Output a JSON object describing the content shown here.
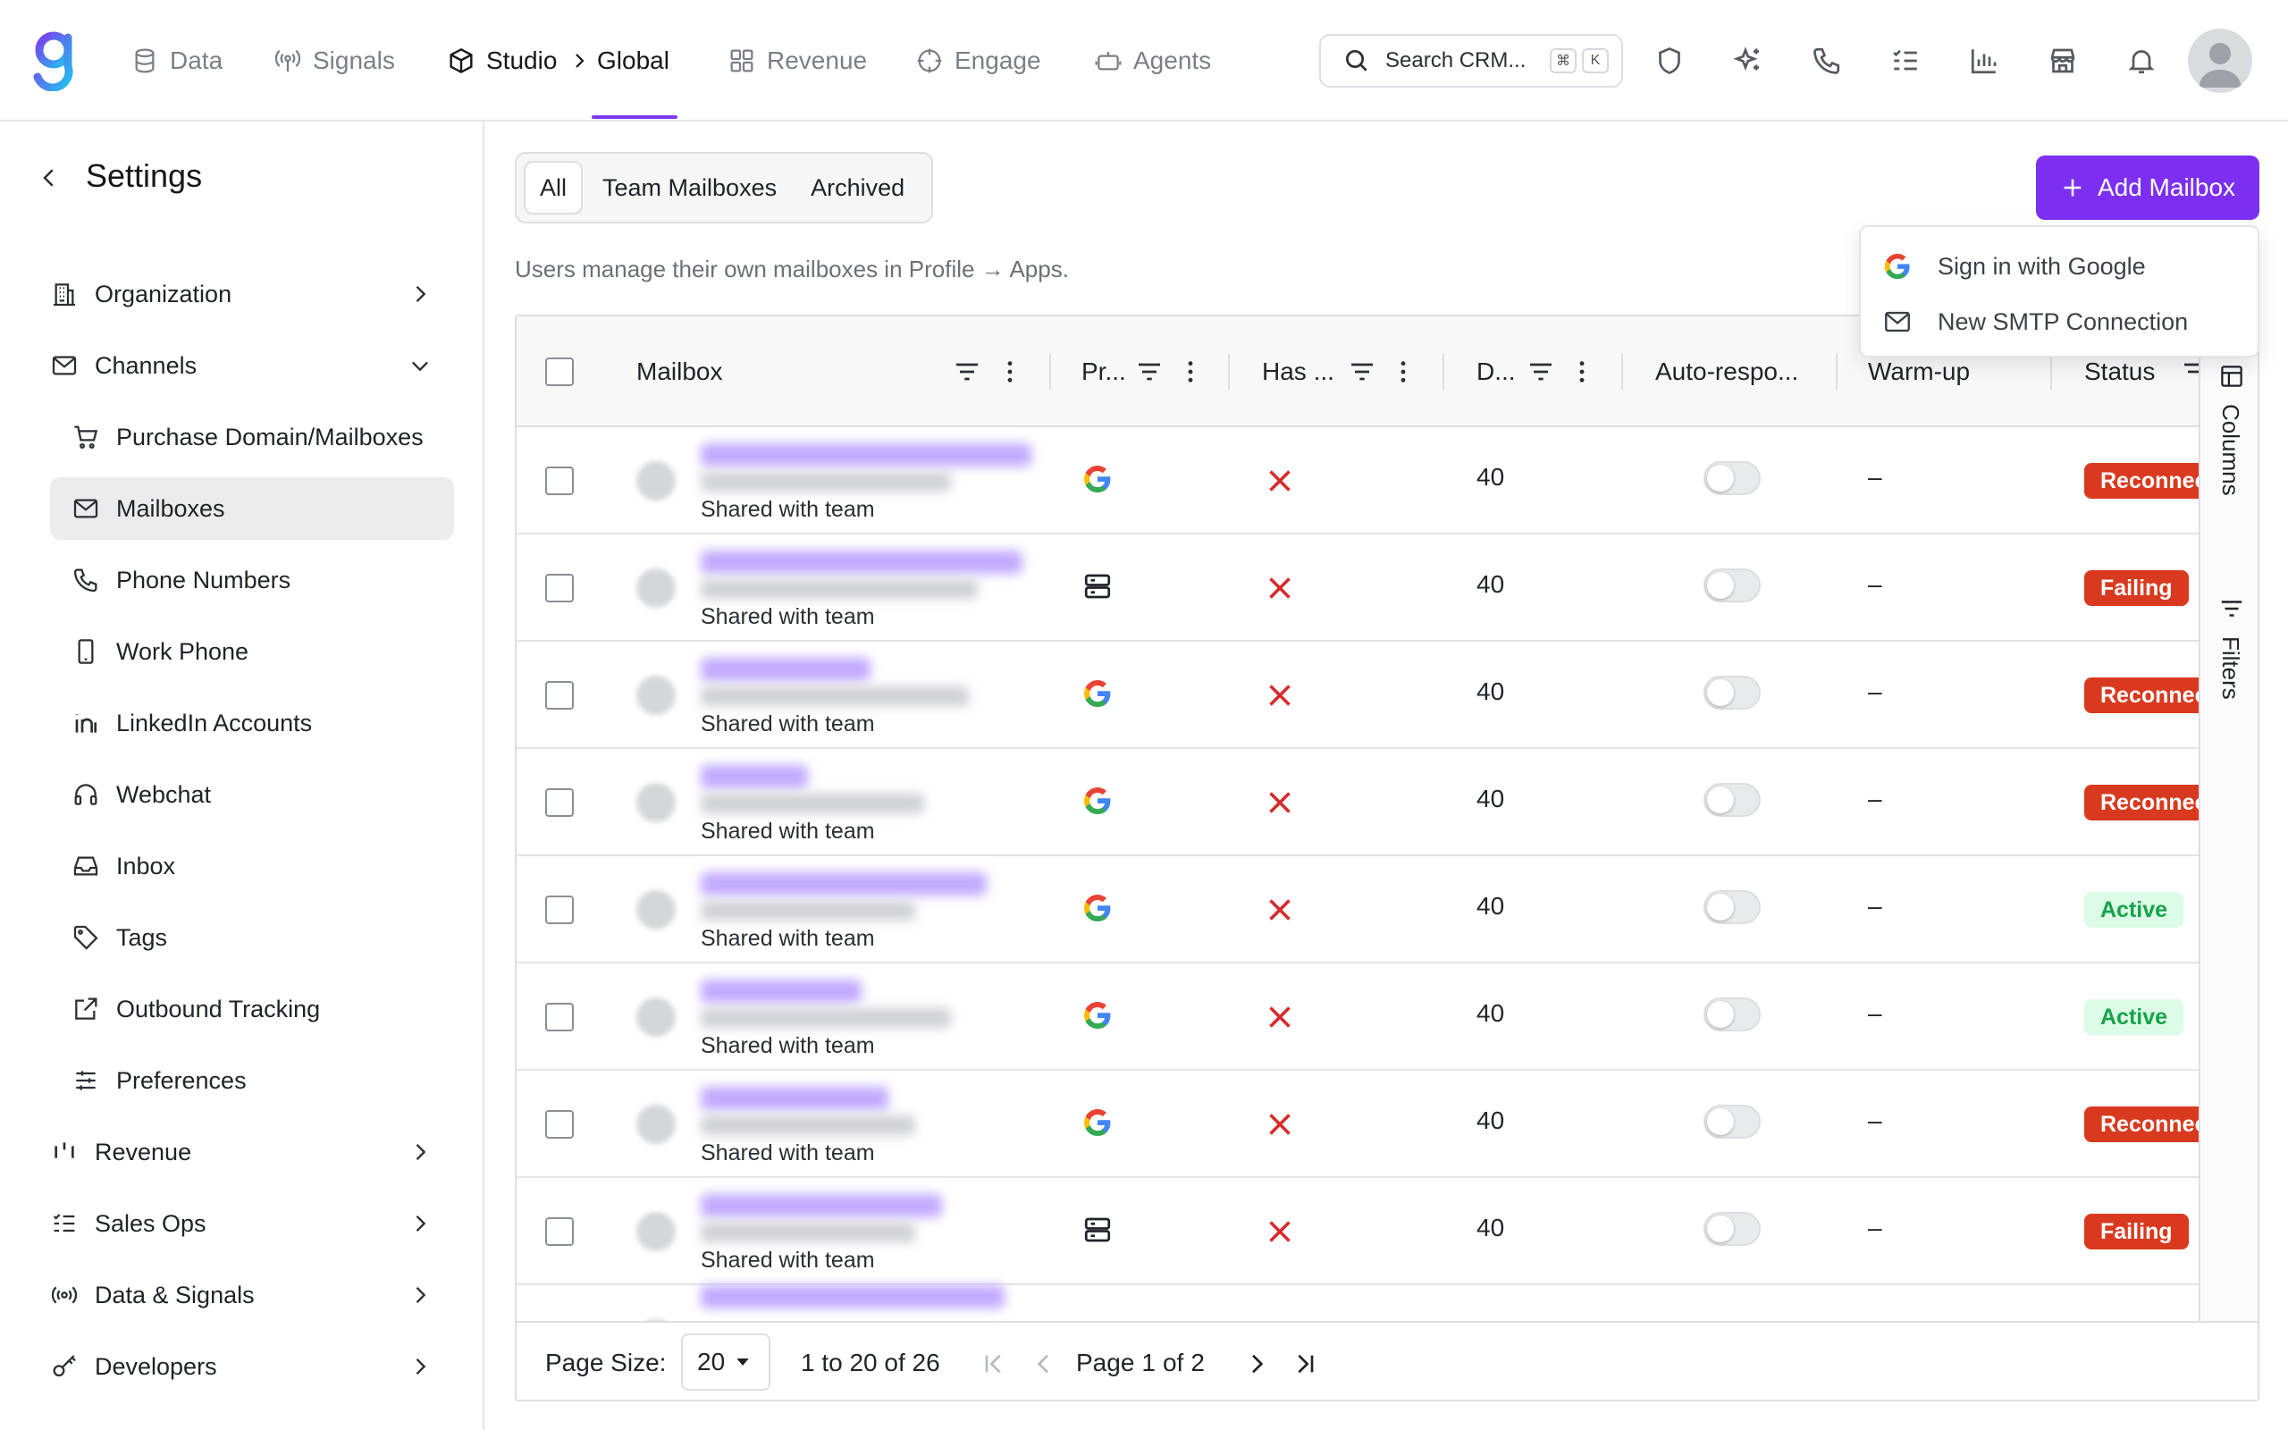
{
  "topnav": {
    "items": [
      {
        "label": "Data",
        "icon": "database-icon"
      },
      {
        "label": "Signals",
        "icon": "signal-icon"
      },
      {
        "label": "Studio",
        "icon": "cube-icon"
      },
      {
        "label": "Global"
      },
      {
        "label": "Revenue",
        "icon": "grid-icon"
      },
      {
        "label": "Engage",
        "icon": "target-icon"
      },
      {
        "label": "Agents",
        "icon": "bot-icon"
      }
    ],
    "search": {
      "placeholder": "Search CRM...",
      "key1": "⌘",
      "key2": "K"
    },
    "accent": "#7c3aed"
  },
  "sidebar": {
    "title": "Settings",
    "items": [
      {
        "label": "Organization"
      },
      {
        "label": "Channels"
      },
      {
        "label": "Purchase Domain/Mailboxes"
      },
      {
        "label": "Mailboxes"
      },
      {
        "label": "Phone Numbers"
      },
      {
        "label": "Work Phone"
      },
      {
        "label": "LinkedIn Accounts"
      },
      {
        "label": "Webchat"
      },
      {
        "label": "Inbox"
      },
      {
        "label": "Tags"
      },
      {
        "label": "Outbound Tracking"
      },
      {
        "label": "Preferences"
      },
      {
        "label": "Revenue"
      },
      {
        "label": "Sales Ops"
      },
      {
        "label": "Data & Signals"
      },
      {
        "label": "Developers"
      }
    ]
  },
  "tabs": {
    "all": "All",
    "team": "Team Mailboxes",
    "archived": "Archived"
  },
  "helper_text": "Users manage their own mailboxes in Profile → Apps.",
  "add_button": {
    "label": "Add Mailbox",
    "color": "#7c2ff0"
  },
  "dropdown": {
    "google": "Sign in with Google",
    "smtp": "New SMTP Connection"
  },
  "table": {
    "headers": {
      "mailbox": "Mailbox",
      "provider": "Pr...",
      "has": "Has ...",
      "daily": "D...",
      "auto": "Auto-respo...",
      "warmup": "Warm-up",
      "status": "Status"
    },
    "rows": [
      {
        "shared": "Shared with team",
        "provider": "google",
        "has": false,
        "daily": "40",
        "warmup": "–",
        "status": "Reconnect",
        "tone": "danger"
      },
      {
        "shared": "Shared with team",
        "provider": "smtp",
        "has": false,
        "daily": "40",
        "warmup": "–",
        "status": "Failing",
        "tone": "danger"
      },
      {
        "shared": "Shared with team",
        "provider": "google",
        "has": false,
        "daily": "40",
        "warmup": "–",
        "status": "Reconnect",
        "tone": "danger"
      },
      {
        "shared": "Shared with team",
        "provider": "google",
        "has": false,
        "daily": "40",
        "warmup": "–",
        "status": "Reconnect",
        "tone": "danger"
      },
      {
        "shared": "Shared with team",
        "provider": "google",
        "has": false,
        "daily": "40",
        "warmup": "–",
        "status": "Active",
        "tone": "success"
      },
      {
        "shared": "Shared with team",
        "provider": "google",
        "has": false,
        "daily": "40",
        "warmup": "–",
        "status": "Active",
        "tone": "success"
      },
      {
        "shared": "Shared with team",
        "provider": "google",
        "has": false,
        "daily": "40",
        "warmup": "–",
        "status": "Reconnect",
        "tone": "danger"
      },
      {
        "shared": "Shared with team",
        "provider": "smtp",
        "has": false,
        "daily": "40",
        "warmup": "–",
        "status": "Failing",
        "tone": "danger"
      }
    ],
    "side_tools": {
      "columns": "Columns",
      "filters": "Filters"
    }
  },
  "pager": {
    "page_size_label": "Page Size:",
    "page_size": "20",
    "range": "1 to 20 of 26",
    "page_word": "Page",
    "page": "1",
    "of_word": "of",
    "total": "2"
  },
  "colors": {
    "danger_bg": "#d93a1f",
    "success_bg": "#dcfce7",
    "success_text": "#16a34a",
    "x_red": "#d62b2b"
  }
}
